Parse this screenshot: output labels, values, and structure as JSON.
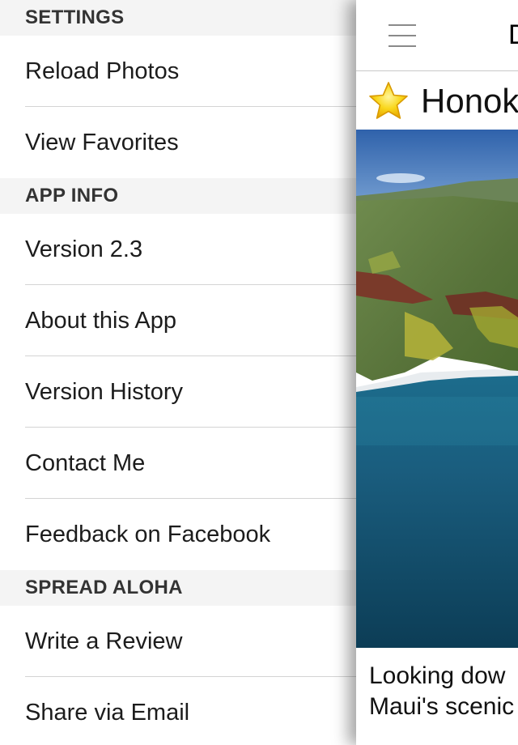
{
  "menu": {
    "sections": [
      {
        "header": "SETTINGS",
        "items": [
          "Reload Photos",
          "View Favorites"
        ]
      },
      {
        "header": "APP INFO",
        "items": [
          "Version 2.3",
          "About this App",
          "Version History",
          "Contact Me",
          "Feedback on Facebook"
        ]
      },
      {
        "header": "SPREAD ALOHA",
        "items": [
          "Write a Review",
          "Share via Email"
        ]
      }
    ]
  },
  "panel": {
    "nav_title": "D",
    "menu_icon": "hamburger-menu-icon",
    "favorite_icon": "star-icon",
    "photo_title": "Honok",
    "caption_line1": "Looking dow",
    "caption_line2": "Maui's scenic"
  },
  "colors": {
    "star_fill": "#f9d71c",
    "star_stroke": "#e0a800",
    "ocean": "#0f4f6e",
    "sky": "#3c74b8",
    "hills": "#5f7a3e"
  }
}
